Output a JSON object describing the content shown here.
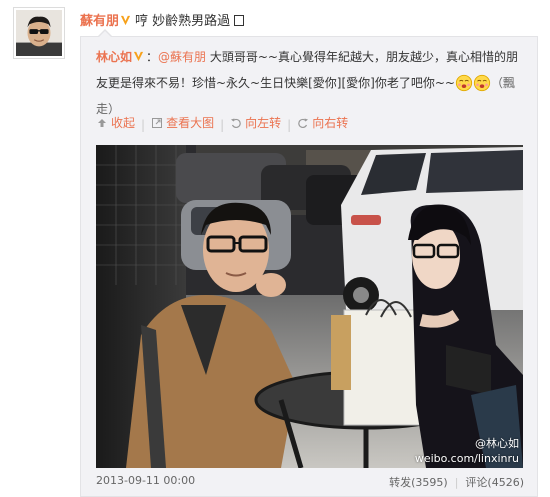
{
  "post": {
    "author": "蘇有朋",
    "text": "哼 妙齡熟男路過"
  },
  "repost": {
    "author": "林心如",
    "mention": "@蘇有朋",
    "text_main": "大頭哥哥~~真心覺得年紀越大，朋友越少，真心相惜的朋友更是得來不易！珍惜~永久~生日快樂[愛你][愛你]你老了吧你~~",
    "text_tail": "（飄走）"
  },
  "toolbar": {
    "collapse": "收起",
    "view_large": "查看大图",
    "rotate_left": "向左转",
    "rotate_right": "向右转"
  },
  "watermark": {
    "name": "@林心如",
    "url": "weibo.com/linxinru"
  },
  "footer": {
    "timestamp": "2013-09-11 00:00",
    "repost_label": "转发",
    "repost_count": "(3595)",
    "comment_label": "评论",
    "comment_count": "(4526)"
  },
  "colors": {
    "accent": "#eb7350",
    "repost_bg": "#f2f2f5",
    "text": "#333333",
    "verified_badge": "#f7a11a"
  },
  "icons": {
    "verified": "verified-v-icon",
    "collapse": "collapse-arrow-icon",
    "view_large": "zoom-icon",
    "rotate_left": "rotate-left-icon",
    "rotate_right": "rotate-right-icon",
    "emoji": "cute-face-emoji-icon",
    "box": "box-glyph"
  }
}
